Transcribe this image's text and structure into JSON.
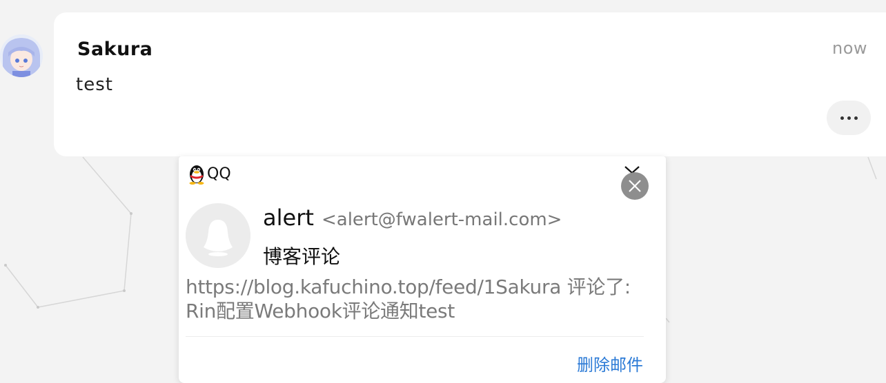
{
  "comment": {
    "author": "Sakura",
    "text": "test",
    "time": "now",
    "more_icon": "ellipsis-icon"
  },
  "notification": {
    "app_name": "QQ",
    "app_icon": "qq-penguin-icon",
    "collapse_icon": "chevron-down-icon",
    "close_icon": "close-icon",
    "sender_name": "alert",
    "sender_email": "<alert@fwalert-mail.com>",
    "subject": "博客评论",
    "body_line1": "https://blog.kafuchino.top/feed/1Sakura 评论了:",
    "body_line2": "Rin配置Webhook评论通知test",
    "delete_label": "删除邮件"
  },
  "colors": {
    "background": "#f3f3f3",
    "card": "#ffffff",
    "link": "#2b7ad6",
    "close_button": "#8e8e8e"
  }
}
